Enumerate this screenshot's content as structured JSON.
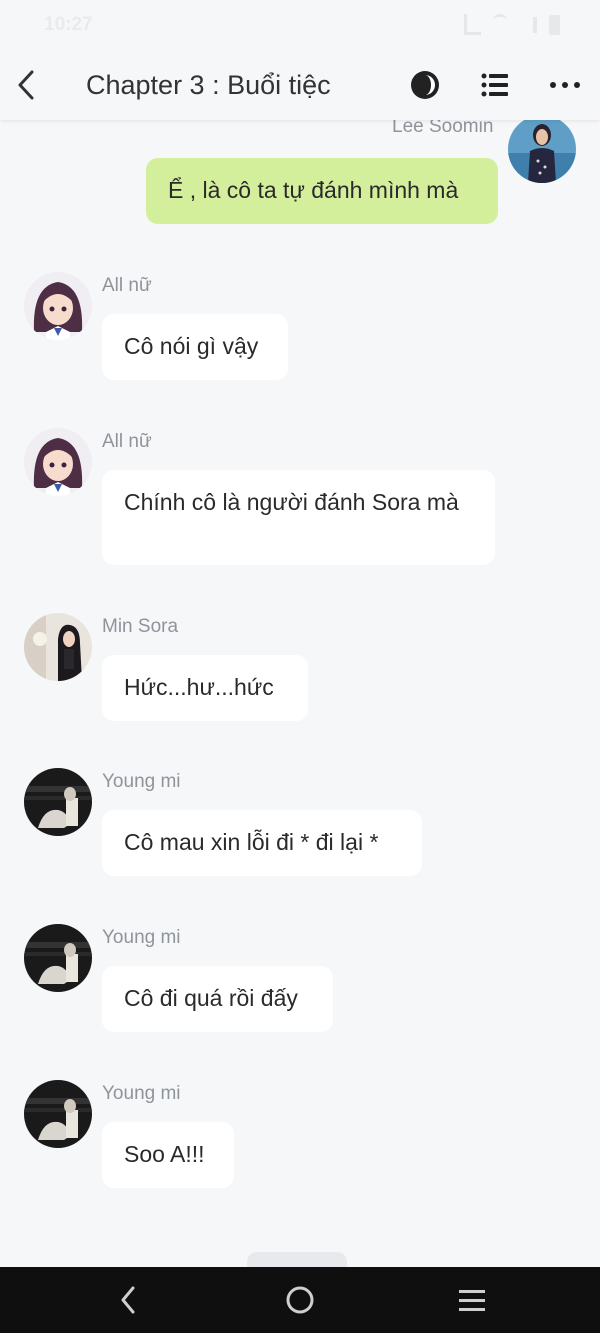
{
  "status_bar": {
    "time": "10:27",
    "icons": [
      "data-icon",
      "wifi-icon",
      "signal-icon",
      "battery-icon"
    ]
  },
  "header": {
    "title": "Chapter 3 : Buổi tiệc",
    "icons": [
      "back-arrow-icon",
      "theme-toggle-icon",
      "chapter-list-icon",
      "more-options-icon"
    ]
  },
  "messages": [
    {
      "sender": "Lee Soomin",
      "text": "Ể , là cô ta tự đánh mình mà",
      "self": true,
      "avatar": "avatar-lee-soomin"
    },
    {
      "sender": "All nữ",
      "text": "Cô nói gì vậy",
      "self": false,
      "avatar": "avatar-all-nu"
    },
    {
      "sender": "All nữ",
      "text": "Chính cô là người đánh Sora mà",
      "self": false,
      "avatar": "avatar-all-nu"
    },
    {
      "sender": "Min Sora",
      "text": "Hức...hư...hức",
      "self": false,
      "avatar": "avatar-min-sora"
    },
    {
      "sender": "Young mi",
      "text": "Cô mau xin lỗi đi * đi lại *",
      "self": false,
      "avatar": "avatar-young-mi"
    },
    {
      "sender": "Young mi",
      "text": "Cô đi quá rồi đấy",
      "self": false,
      "avatar": "avatar-young-mi"
    },
    {
      "sender": "Young mi",
      "text": "Soo A!!!",
      "self": false,
      "avatar": "avatar-young-mi"
    }
  ],
  "colors": {
    "background": "#f6f7f9",
    "self_bubble": "#d4ef9c",
    "other_bubble": "#ffffff",
    "name_text": "#8f949b",
    "nav_bar": "#0f0f10"
  },
  "nav_bar": {
    "icons": [
      "nav-back-icon",
      "nav-home-icon",
      "nav-recents-icon"
    ]
  }
}
